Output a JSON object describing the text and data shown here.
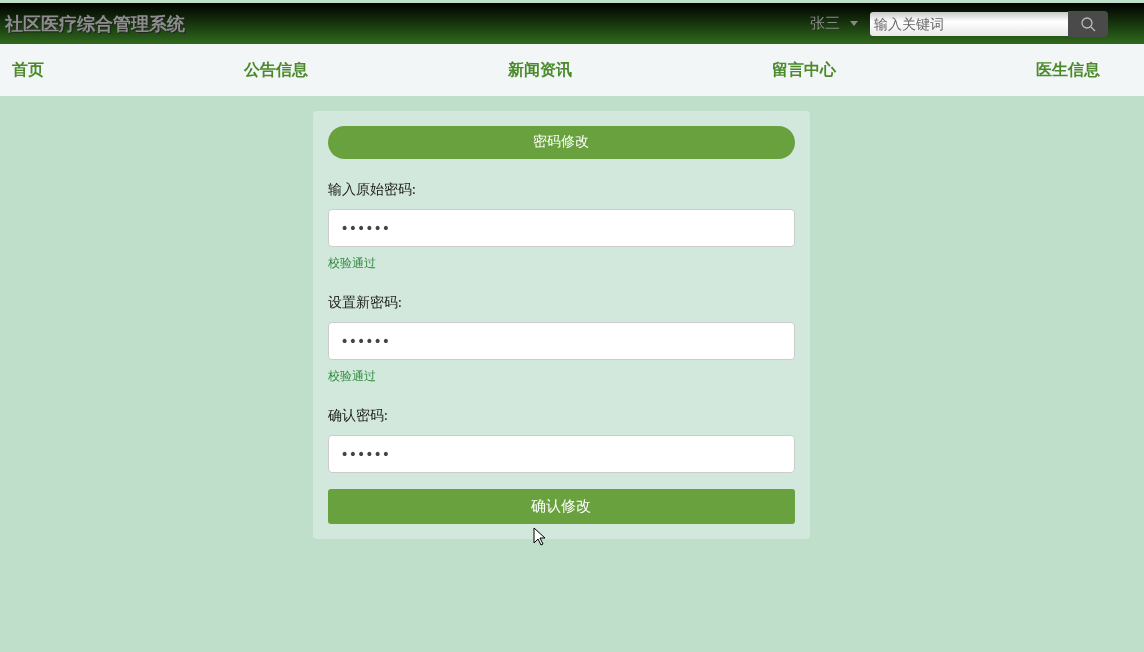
{
  "header": {
    "title": "社区医疗综合管理系统",
    "user": "张三",
    "search": {
      "placeholder": "输入关键词"
    }
  },
  "nav": [
    {
      "label": "首页"
    },
    {
      "label": "公告信息"
    },
    {
      "label": "新闻资讯"
    },
    {
      "label": "留言中心"
    },
    {
      "label": "医生信息"
    }
  ],
  "form": {
    "title": "密码修改",
    "fields": [
      {
        "label": "输入原始密码:",
        "value": "••••••",
        "hint": "校验通过"
      },
      {
        "label": "设置新密码:",
        "value": "••••••",
        "hint": "校验通过"
      },
      {
        "label": "确认密码:",
        "value": "••••••"
      }
    ],
    "submit": "确认修改"
  }
}
